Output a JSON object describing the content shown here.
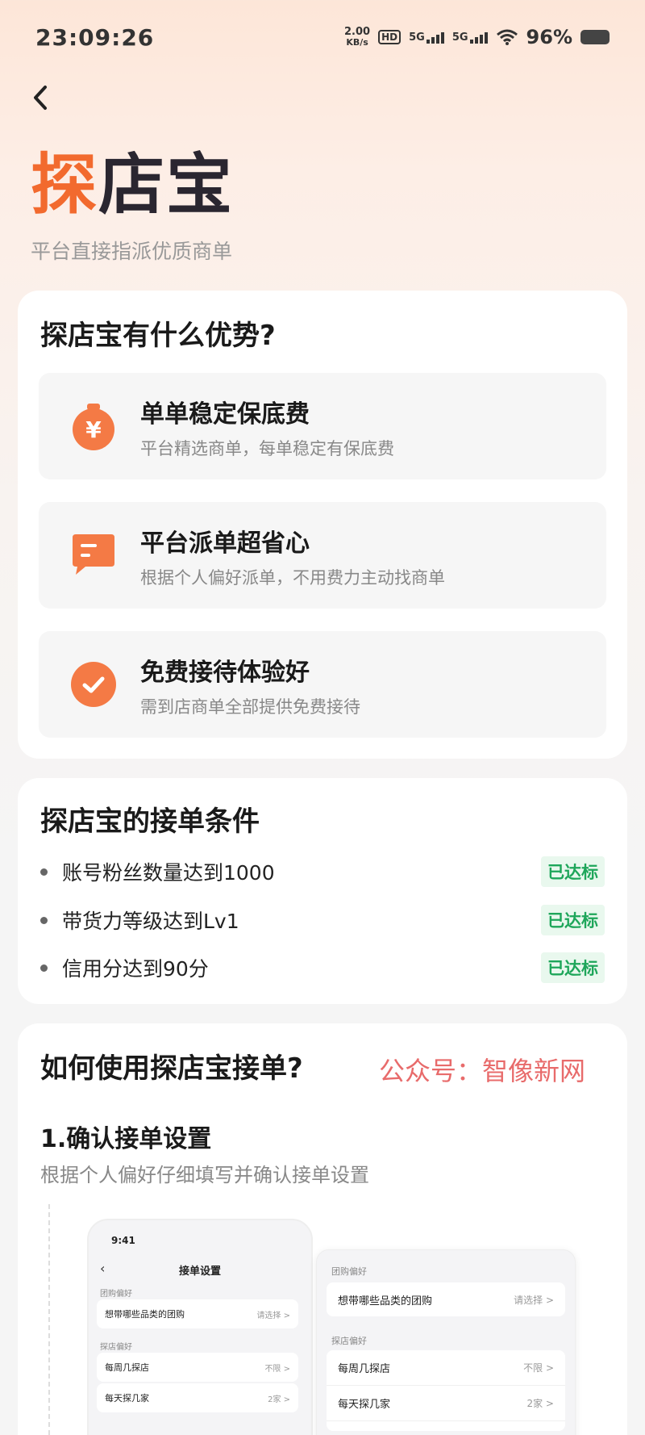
{
  "status_bar": {
    "time": "23:09:26",
    "speed_value": "2.00",
    "speed_unit": "KB/s",
    "hd_label": "HD",
    "sim1_label": "5G",
    "sim2_label": "5G",
    "battery_percent": "96%"
  },
  "header": {
    "logo_part1": "探",
    "logo_part2": "店宝",
    "subtitle": "平台直接指派优质商单"
  },
  "advantages": {
    "title": "探店宝有什么优势?",
    "items": [
      {
        "heading": "单单稳定保底费",
        "desc": "平台精选商单，每单稳定有保底费",
        "icon": "money-bag-icon"
      },
      {
        "heading": "平台派单超省心",
        "desc": "根据个人偏好派单，不用费力主动找商单",
        "icon": "message-icon"
      },
      {
        "heading": "免费接待体验好",
        "desc": "需到店商单全部提供免费接待",
        "icon": "check-circle-icon"
      }
    ]
  },
  "conditions": {
    "title": "探店宝的接单条件",
    "items": [
      {
        "text": "账号粉丝数量达到1000",
        "status": "已达标"
      },
      {
        "text": "带货力等级达到Lv1",
        "status": "已达标"
      },
      {
        "text": "信用分达到90分",
        "status": "已达标"
      }
    ]
  },
  "howto": {
    "title": "如何使用探店宝接单?",
    "watermark": "公众号：智像新网",
    "step1_title": "1.确认接单设置",
    "step1_desc": "根据个人偏好仔细填写并确认接单设置"
  },
  "preview_phone": {
    "time": "9:41",
    "header": "接单设置",
    "section1": "团购偏好",
    "row1_label": "想带哪些品类的团购",
    "row1_value": "请选择 >",
    "section2": "探店偏好",
    "row2_label": "每周几探店",
    "row2_value": "不限 >",
    "row3_label": "每天探几家",
    "row3_value": "2家 >"
  },
  "preview_panel": {
    "section1": "团购偏好",
    "row1_label": "想带哪些品类的团购",
    "row1_value": "请选择 >",
    "section2": "探店偏好",
    "row2_label": "每周几探店",
    "row2_value": "不限 >",
    "row3_label": "每天探几家",
    "row3_value": "2家 >"
  },
  "colors": {
    "accent": "#f26a2e",
    "success": "#1ea65a",
    "watermark": "#e86b6b"
  }
}
